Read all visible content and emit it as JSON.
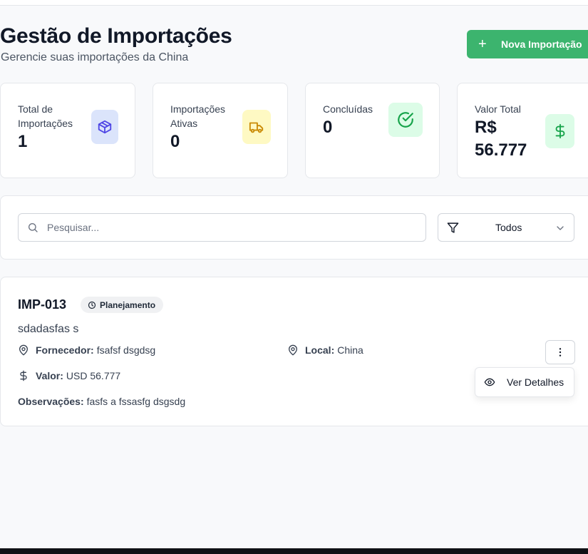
{
  "header": {
    "title": "Gestão de Importações",
    "subtitle": "Gerencie suas importações da China",
    "new_button_label": "Nova Importação"
  },
  "stats": [
    {
      "label": "Total de Importações",
      "value": "1",
      "icon": "package-icon",
      "icon_bg": "#dbe4fb",
      "icon_color": "#4f46e5"
    },
    {
      "label": "Importações Ativas",
      "value": "0",
      "icon": "truck-icon",
      "icon_bg": "#fef9c3",
      "icon_color": "#ca8a04"
    },
    {
      "label": "Concluídas",
      "value": "0",
      "icon": "check-circle-icon",
      "icon_bg": "#dcfce7",
      "icon_color": "#16a34a"
    },
    {
      "label": "Valor Total",
      "value": "R$ 56.777",
      "icon": "dollar-icon",
      "icon_bg": "#dcfce7",
      "icon_color": "#16a34a"
    }
  ],
  "filters": {
    "search_placeholder": "Pesquisar...",
    "status_value": "Todos"
  },
  "import": {
    "code": "IMP-013",
    "status": "Planejamento",
    "description": "sdadasfas s",
    "supplier_label": "Fornecedor:",
    "supplier": "fsafsf dsgdsg",
    "location_label": "Local:",
    "location": "China",
    "value_label": "Valor:",
    "value": "USD 56.777",
    "notes_label": "Observações:",
    "notes": "fasfs a fssasfg dsgsdg"
  },
  "menu": {
    "view_details_label": "Ver Detalhes"
  },
  "colors": {
    "accent": "#3cb46e",
    "background": "#f8f9fb"
  }
}
